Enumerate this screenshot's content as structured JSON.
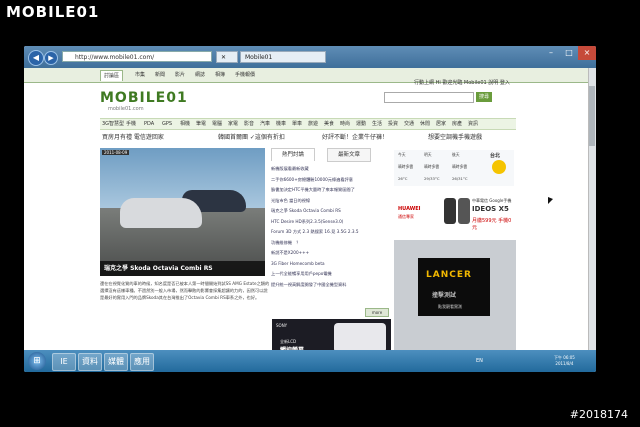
{
  "watermark": {
    "logo": "MOBILE01",
    "id": "#2018174"
  },
  "browser": {
    "address": "http://www.mobile01.com/",
    "tabs": [
      "Mobile01",
      "Mobile01"
    ],
    "window_controls": [
      "–",
      "□",
      "×"
    ]
  },
  "site": {
    "top_tabs": [
      "討論區",
      "市集",
      "新聞",
      "影片",
      "網誌",
      "相簿",
      "手機報價"
    ],
    "login": "行動上網  Hi 歡迎光臨 Mobile01  說明  登入",
    "logo": "MOBILE01",
    "logo_sub": "mobile01.com",
    "search_label": "搜尋",
    "menu": [
      "3G智慧型",
      "手機",
      "PDA",
      "GPS",
      "相機",
      "筆電",
      "電腦",
      "家電",
      "影音",
      "汽車",
      "機車",
      "單車",
      "旅遊",
      "美食",
      "時尚",
      "運動",
      "生活",
      "投資",
      "交通",
      "休閒",
      "居家",
      "房產",
      "資訊"
    ],
    "promos": [
      "買房月有禮 電信遊回家",
      "韓國首爾團 ✓這個有折扣",
      "好評不斷！企業牛仔褲！",
      "想要空調機手機遊戲"
    ],
    "feature": {
      "badge": "2011-08-09",
      "caption": "瑞克之爭 Skoda Octavia Combi RS",
      "desc": "還在在視覺化質的車的時候，知名度是否已被本人第一時間開始到試SS AMG Estate之類的選擇沒有這樣車種。不過然別一般入市場，然而擊敗的影響會採集超讓的力的，因然可以說是最好的實用入門的品牌Skoda其在台灣推出了Octavia Combi RS車系之外，也好。"
    },
    "news_tabs": [
      "熱門討論",
      "最新文章"
    ],
    "news": [
      "新機版展看最新收藏",
      "二手你6600+房總體驗10000元條遍看評意",
      "臉書加決定HTC平機大量時了來本報質區間了",
      "光陰市色 當日的視線",
      "瑞克之爭 Skoda Octavia Combi RS",
      "HTC Desire HD系列2.3.5(Sense3.0)",
      "Forum 3D 方式 2.3 熱搜索 16.見 3.5G 2.3.5",
      "功機維修機　？",
      "新說不是X200+++",
      "3G Fiber Homecomb beta",
      "上一代全能暢享用用戶pepo電機",
      "提升統一視高解度開發了中國全機型資料"
    ],
    "more": "more",
    "sony_ad": {
      "brand": "SONY",
      "tag": "全新LCD",
      "headline": "觸控螢幕"
    },
    "weather": {
      "city": "台北",
      "cols": [
        {
          "label": "今天",
          "temp": "26°C"
        },
        {
          "label": "明天",
          "temp": "29/33°C"
        },
        {
          "label": "後天",
          "temp": "26/31°C"
        }
      ],
      "conds": [
        "晴時多雲",
        "晴時多雲",
        "晴時多雲"
      ]
    },
    "huawei_ad": {
      "brand": "HUAWEI",
      "sub": "通信專家",
      "line1": "中華電信 Google手機",
      "model": "IDEOS X5",
      "price": "月繳599元 手機0元"
    },
    "lancer_ad": {
      "title": "LANCER",
      "subtitle": "撞擊測試",
      "cta": "點我觀看實測"
    }
  },
  "taskbar": {
    "start": "⊞",
    "apps": [
      "IE",
      "資料夾",
      "媒體",
      "應用"
    ],
    "tray": "EN",
    "time": "下午 06:05",
    "date": "2011/8/4"
  }
}
